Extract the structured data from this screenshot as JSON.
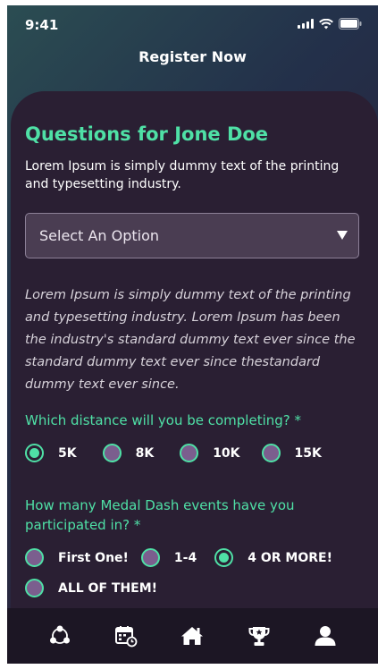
{
  "status_bar": {
    "time": "9:41"
  },
  "header": {
    "title": "Register Now"
  },
  "form": {
    "title": "Questions for Jone Doe",
    "intro": "Lorem Ipsum is simply dummy text of the printing and typesetting industry.",
    "select": {
      "value": "Select An Option"
    },
    "description": "Lorem Ipsum is simply dummy text of the printing and typesetting industry. Lorem Ipsum has been the industry's standard dummy text ever since the standard dummy text ever since thestandard dummy text ever since.",
    "distance": {
      "question": "Which distance will you be completing? *",
      "options": [
        "5K",
        "8K",
        "10K",
        "15K"
      ],
      "selected": "5K"
    },
    "events": {
      "question": "How many Medal Dash events have you participated in? *",
      "options": [
        "First One!",
        "1-4",
        "4 OR MORE!",
        "ALL OF THEM!"
      ],
      "selected": "4 OR MORE!"
    }
  },
  "colors": {
    "accent": "#4fe0a6",
    "card": "#2a1f33",
    "nav": "#1c1624"
  },
  "bottom_nav": {
    "items": [
      "community-icon",
      "calendar-icon",
      "home-icon",
      "trophy-icon",
      "profile-icon"
    ]
  }
}
